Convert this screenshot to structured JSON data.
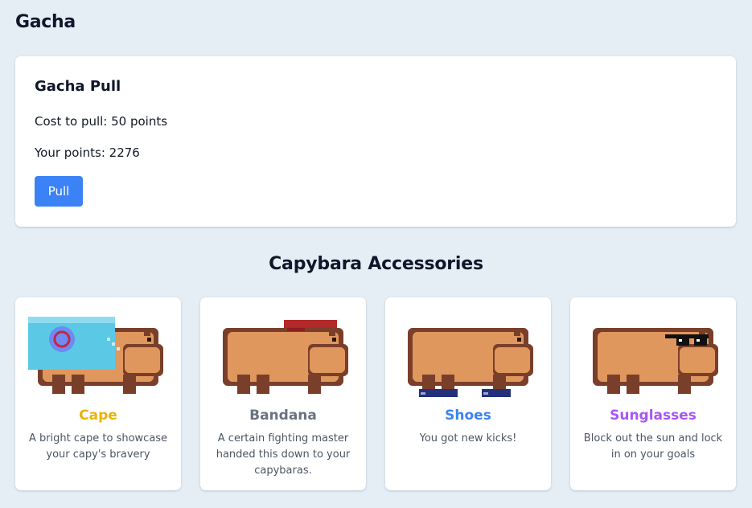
{
  "page": {
    "title": "Gacha"
  },
  "pull_card": {
    "title": "Gacha Pull",
    "cost_text": "Cost to pull: 50 points",
    "points_text": "Your points: 2276",
    "pull_label": "Pull"
  },
  "accessories": {
    "title": "Capybara Accessories",
    "items": [
      {
        "name": "Cape",
        "description": "A bright cape to showcase your capy's bravery",
        "color": "#eab308",
        "icon": "capybara-cape-icon"
      },
      {
        "name": "Bandana",
        "description": "A certain fighting master handed this down to your capybaras.",
        "color": "#6b7280",
        "icon": "capybara-bandana-icon"
      },
      {
        "name": "Shoes",
        "description": "You got new kicks!",
        "color": "#3b82f6",
        "icon": "capybara-shoes-icon"
      },
      {
        "name": "Sunglasses",
        "description": "Block out the sun and lock in on your goals",
        "color": "#a855f7",
        "icon": "capybara-sunglasses-icon"
      }
    ]
  },
  "colors": {
    "background": "#e5edf5",
    "primary": "#3b82f6",
    "capybara": "#e0975d",
    "capybara_outline": "#7a3f2a"
  }
}
